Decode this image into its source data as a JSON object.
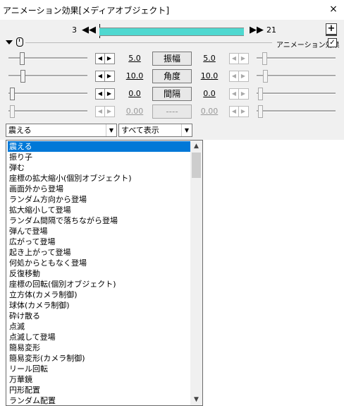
{
  "window": {
    "title": "アニメーション効果[メディアオブジェクト]",
    "close": "×"
  },
  "frames": {
    "start": "3",
    "end": "21",
    "prev": "◀◀",
    "next": "▶▶",
    "add": "+"
  },
  "header": {
    "anim_label": "アニメーション効果",
    "checked": "✓"
  },
  "params": [
    {
      "left": "5.0",
      "label": "振幅",
      "right": "5.0",
      "enabled": true
    },
    {
      "left": "10.0",
      "label": "角度",
      "right": "10.0",
      "enabled": true
    },
    {
      "left": "0.0",
      "label": "間隔",
      "right": "0.0",
      "enabled": true
    },
    {
      "left": "0.00",
      "label": "----",
      "right": "0.00",
      "enabled": false
    }
  ],
  "spin": {
    "left": "◀",
    "right": "▶"
  },
  "selects": {
    "effect": "震える",
    "filter": "すべて表示",
    "arrow": "▼"
  },
  "list": {
    "selected_index": 0,
    "items": [
      "震える",
      "振り子",
      "弾む",
      "座標の拡大縮小(個別オブジェクト)",
      "画面外から登場",
      "ランダム方向から登場",
      "拡大縮小して登場",
      "ランダム間隔で落ちながら登場",
      "弾んで登場",
      "広がって登場",
      "起き上がって登場",
      "何処からともなく登場",
      "反復移動",
      "座標の回転(個別オブジェクト)",
      "立方体(カメラ制御)",
      "球体(カメラ制御)",
      "砕け散る",
      "点滅",
      "点滅して登場",
      "簡易変形",
      "簡易変形(カメラ制御)",
      "リール回転",
      "万華鏡",
      "円形配置",
      "ランダム配置"
    ],
    "scroll_up": "▲",
    "scroll_down": "▼"
  }
}
